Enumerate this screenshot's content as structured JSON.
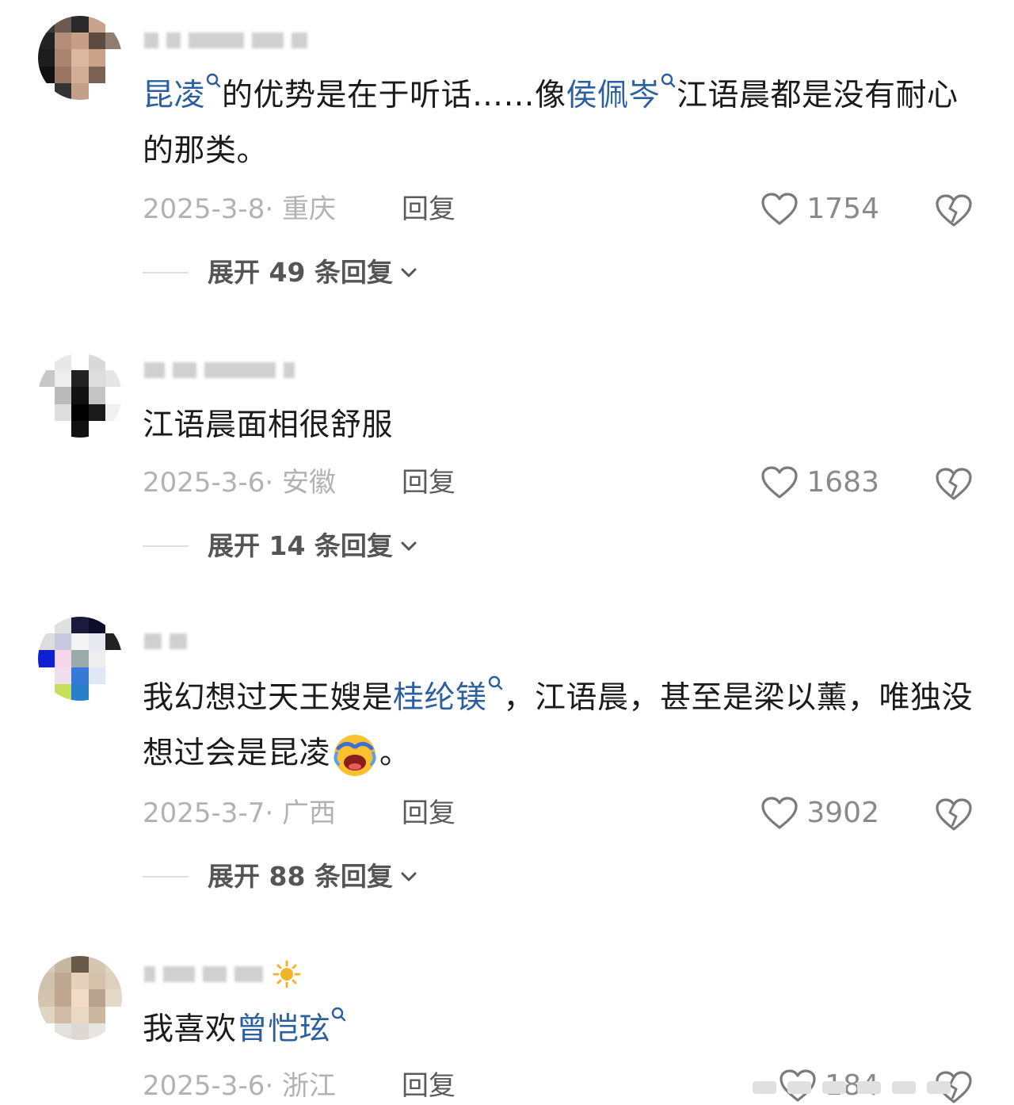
{
  "comments": [
    {
      "text_parts": [
        {
          "text": "昆凌",
          "link": true
        },
        {
          "text": "的优势是在于听话……像",
          "link": false
        },
        {
          "text": "侯佩岑",
          "link": true
        },
        {
          "text": "江语晨都是没有耐心的那类。",
          "link": false
        }
      ],
      "date": "2025-3-8",
      "location": "重庆",
      "reply_label": "回复",
      "likes": "1754",
      "expand_label": "展开 49 条回复"
    },
    {
      "text_parts": [
        {
          "text": "江语晨面相很舒服",
          "link": false
        }
      ],
      "date": "2025-3-6",
      "location": "安徽",
      "reply_label": "回复",
      "likes": "1683",
      "expand_label": "展开 14 条回复"
    },
    {
      "text_parts": [
        {
          "text": "我幻想过天王嫂是",
          "link": false
        },
        {
          "text": "桂纶镁",
          "link": true
        },
        {
          "text": "，江语晨，甚至是梁以薰，唯独没想过会是昆凌",
          "link": false
        },
        {
          "text": "。",
          "link": false
        }
      ],
      "date": "2025-3-7",
      "location": "广西",
      "reply_label": "回复",
      "likes": "3902",
      "expand_label": "展开 88 条回复"
    },
    {
      "text_parts": [
        {
          "text": "我喜欢",
          "link": false
        },
        {
          "text": "曾恺玹",
          "link": true
        }
      ],
      "date": "2025-3-6",
      "location": "浙江",
      "reply_label": "回复",
      "likes": "184"
    }
  ],
  "icons": {
    "like": "heart-outline-icon",
    "dislike": "broken-heart-icon",
    "search": "search-icon",
    "expand": "chevron-down-icon",
    "emoji": "laughing-crying-emoji",
    "badge": "sun-badge-icon"
  },
  "colors": {
    "link": "#2b5f9e",
    "text": "#1b1b1b",
    "meta": "#b2b2b2",
    "background": "#ffffff"
  }
}
